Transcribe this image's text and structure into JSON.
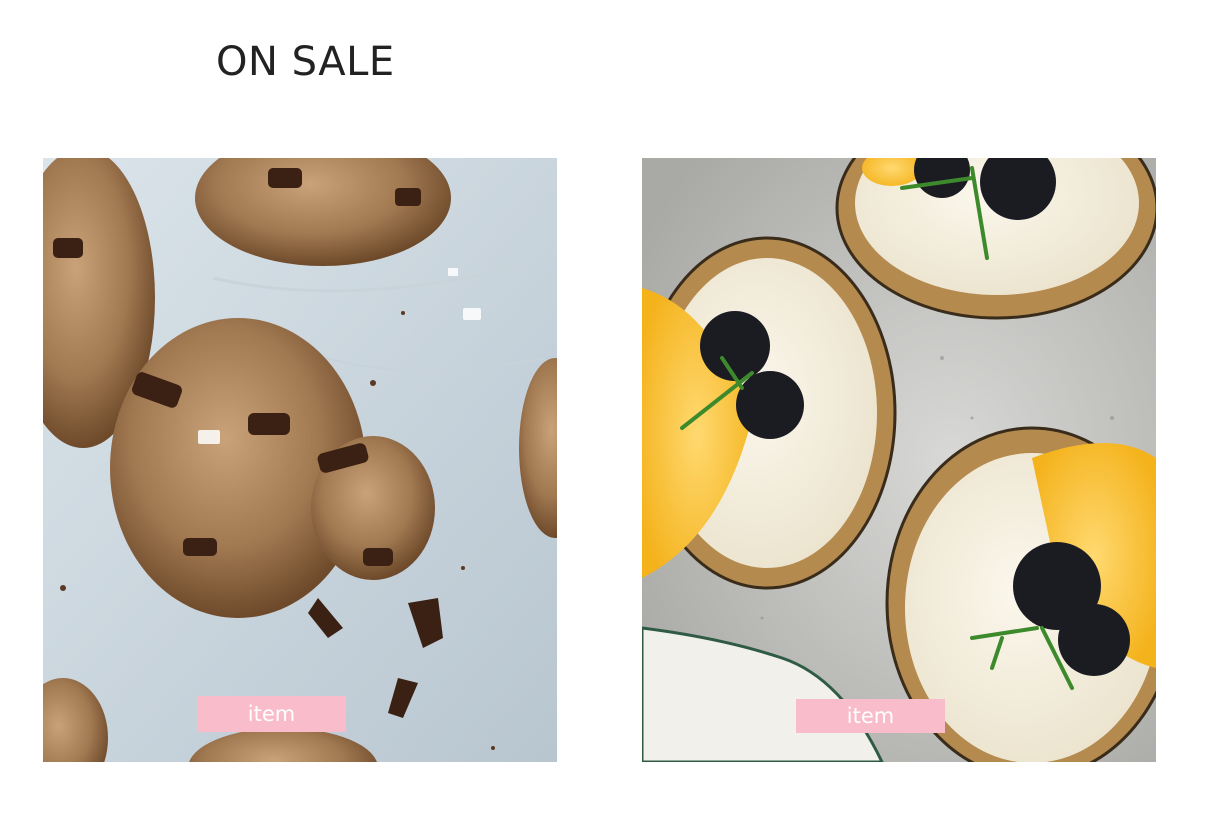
{
  "heading": "ON SALE",
  "products": [
    {
      "image": "chocolate-chip-cookies-photo",
      "label": "item"
    },
    {
      "image": "blackberry-orange-tarts-photo",
      "label": "item"
    }
  ],
  "colors": {
    "tag_background": "#f8bccb",
    "tag_text": "#ffffff",
    "heading_text": "#222222"
  }
}
